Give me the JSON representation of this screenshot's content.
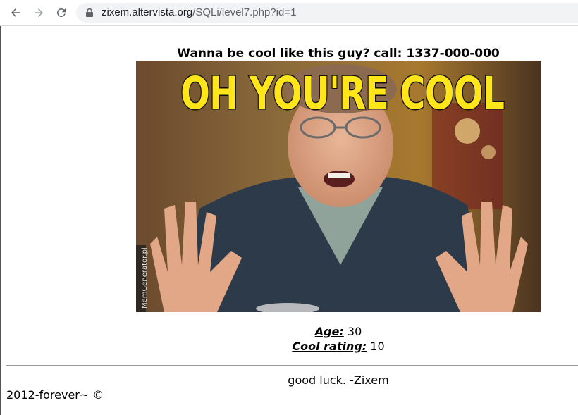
{
  "browser": {
    "url_host": "zixem.altervista.org",
    "url_path": "/SQLi/level7.php?id=1",
    "icons": [
      "back-arrow-icon",
      "forward-arrow-icon",
      "reload-icon",
      "lock-icon"
    ]
  },
  "page": {
    "headline": "Wanna be cool like this guy? call: 1337-000-000",
    "meme": {
      "caption": "OH YOU'RE COOL",
      "watermark": "MemGenerator.pl"
    },
    "age_label": "Age:",
    "age_value": "30",
    "rating_label": "Cool rating:",
    "rating_value": "10",
    "signoff": "good luck. -Zixem",
    "footer": "2012-forever~ ©"
  },
  "colors": {
    "caption_fill": "#ffe51a",
    "omnibox_bg": "#f1f3f4"
  }
}
